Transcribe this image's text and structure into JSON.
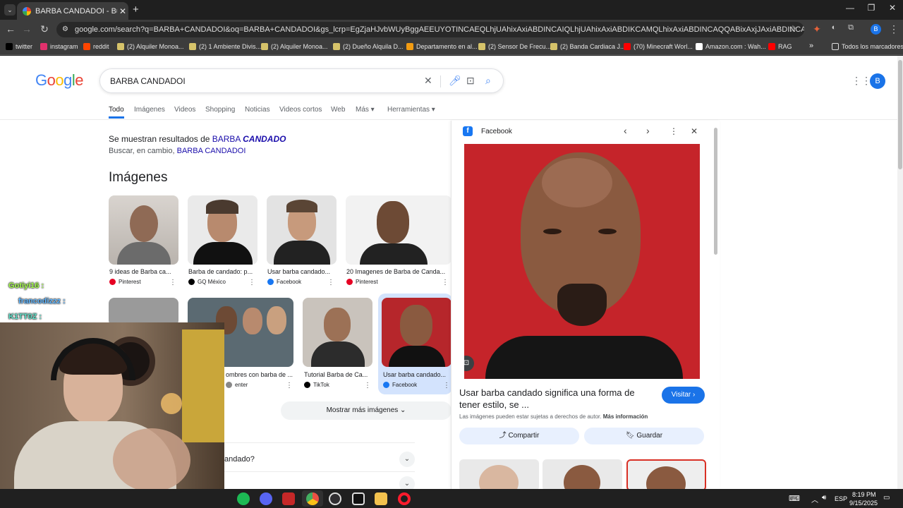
{
  "browser": {
    "tab_title": "BARBA CANDADOI - Buscar con Google",
    "url": "google.com/search?q=BARBA+CANDADOI&oq=BARBA+CANDADOI&gs_lcrp=EgZjaHJvbWUyBggAEEUYOTINCAEQLhjUAhixAxiABDINCAIQLhjUAhixAxiABDIKCAMQLhixAxiABDINCAQQABixAxjJAxiABDINCAUQABiSAxiABBiKBTINCAYQABiSAxiAB...",
    "url_host": "google.com",
    "bookmarks": [
      {
        "label": "twitter",
        "color": "#000000"
      },
      {
        "label": "instagram",
        "color": "#e1306c"
      },
      {
        "label": "reddit",
        "color": "#ff4500"
      },
      {
        "label": "(2) Alquiler Monoa...",
        "color": "#d6c36a"
      },
      {
        "label": "(2) 1 Ambiente Divis...",
        "color": "#d6c36a"
      },
      {
        "label": "(2) Alquiler Monoa...",
        "color": "#d6c36a"
      },
      {
        "label": "(2) Dueño Alquila D...",
        "color": "#d6c36a"
      },
      {
        "label": "Departamento en al...",
        "color": "#f39c12"
      },
      {
        "label": "(2) Sensor De Frecu...",
        "color": "#d6c36a"
      },
      {
        "label": "(2) Banda Cardiaca J...",
        "color": "#d6c36a"
      },
      {
        "label": "(70) Minecraft Worl...",
        "color": "#ff0000"
      },
      {
        "label": "Amazon.com : Wah...",
        "color": "#ffffff"
      },
      {
        "label": "RAG",
        "color": "#ff0000"
      }
    ],
    "bookmarks_more": "»",
    "all_bookmarks": "Todos los marcadores",
    "profile_initial": "B"
  },
  "google": {
    "logo": "Google",
    "query": "BARBA CANDADOI",
    "tabs": [
      "Todo",
      "Imágenes",
      "Videos",
      "Shopping",
      "Noticias",
      "Videos cortos",
      "Web",
      "Más ▾",
      "Herramientas ▾"
    ],
    "showing_prefix": "Se muestran resultados de ",
    "showing_term1": "BARBA ",
    "showing_term2": "CANDADO",
    "instead_prefix": "Buscar, en cambio, ",
    "instead_term": "BARBA CANDADOI",
    "images_heading": "Imágenes",
    "row1": [
      {
        "caption": "9 ideas de Barba ca...",
        "source": "Pinterest",
        "source_color": "#e60023"
      },
      {
        "caption": "Barba de candado: p...",
        "source": "GQ México",
        "source_color": "#000000"
      },
      {
        "caption": "Usar barba candado...",
        "source": "Facebook",
        "source_color": "#1877f2"
      },
      {
        "caption": "20 Imagenes de Barba de Canda...",
        "source": "Pinterest",
        "source_color": "#e60023"
      }
    ],
    "row2": [
      {
        "caption": "ombres con barba de ...",
        "source": "enter",
        "source_color": "#888888"
      },
      {
        "caption": "Tutorial Barba de Ca...",
        "source": "TikTok",
        "source_color": "#000000"
      },
      {
        "caption": "Usar barba candado...",
        "source": "Facebook",
        "source_color": "#1877f2"
      }
    ],
    "more_images": "Mostrar más imágenes  ⌄",
    "faq1": "andado?",
    "user_initial": "B"
  },
  "panel": {
    "source": "Facebook",
    "title": "Usar barba candado significa una forma de tener estilo, se ...",
    "visit": "Visitar ›",
    "copyright": "Las imágenes pueden estar sujetas a derechos de autor.",
    "more_info": "Más información",
    "share": "Compartir",
    "save": "Guardar"
  },
  "chat": [
    {
      "user": "Gotiyi16 :",
      "color": "#a6ff4d"
    },
    {
      "user": "francodizzz :",
      "color": "#5fb6ff"
    },
    {
      "user": "K1TT0Z :",
      "color": "#5fe0c8"
    }
  ],
  "taskbar": {
    "lang": "ESP",
    "time": "8:19 PM",
    "date": "9/15/2025"
  },
  "colors": {
    "accent": "#1a73e8",
    "link": "#1a0dab",
    "selected_thumb_bg": "#d3e3fd"
  }
}
